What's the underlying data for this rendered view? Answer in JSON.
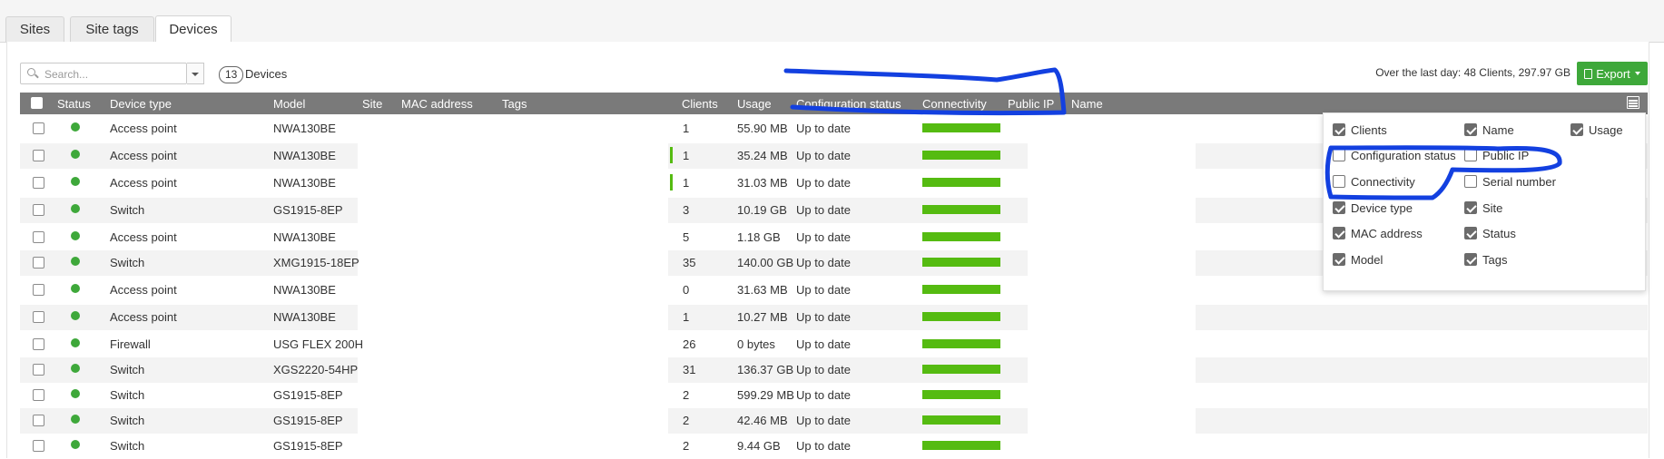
{
  "tabs": [
    {
      "label": "Sites",
      "active": false
    },
    {
      "label": "Site tags",
      "active": false
    },
    {
      "label": "Devices",
      "active": true
    }
  ],
  "toolbar": {
    "search_placeholder": "Search...",
    "device_count": "13",
    "device_count_label": "Devices",
    "summary": "Over the last day: 48 Clients, 297.97 GB",
    "export_label": "Export"
  },
  "columns": {
    "status": "Status",
    "device_type": "Device type",
    "model": "Model",
    "site": "Site",
    "mac": "MAC address",
    "tags": "Tags",
    "clients": "Clients",
    "usage": "Usage",
    "config": "Configuration status",
    "connectivity": "Connectivity",
    "public_ip": "Public IP",
    "name": "Name"
  },
  "rows": [
    {
      "type": "Access point",
      "model": "NWA130BE",
      "clients": "1",
      "usage": "55.90 MB",
      "config": "Up to date",
      "usage_bar": false
    },
    {
      "type": "Access point",
      "model": "NWA130BE",
      "clients": "1",
      "usage": "35.24 MB",
      "config": "Up to date",
      "usage_bar": true
    },
    {
      "type": "Access point",
      "model": "NWA130BE",
      "clients": "1",
      "usage": "31.03 MB",
      "config": "Up to date",
      "usage_bar": true
    },
    {
      "type": "Switch",
      "model": "GS1915-8EP",
      "clients": "3",
      "usage": "10.19 GB",
      "config": "Up to date",
      "usage_bar": false
    },
    {
      "type": "Access point",
      "model": "NWA130BE",
      "clients": "5",
      "usage": "1.18 GB",
      "config": "Up to date",
      "usage_bar": false
    },
    {
      "type": "Switch",
      "model": "XMG1915-18EP",
      "clients": "35",
      "usage": "140.00 GB",
      "config": "Up to date",
      "usage_bar": false
    },
    {
      "type": "Access point",
      "model": "NWA130BE",
      "clients": "0",
      "usage": "31.63 MB",
      "config": "Up to date",
      "usage_bar": false
    },
    {
      "type": "Access point",
      "model": "NWA130BE",
      "clients": "1",
      "usage": "10.27 MB",
      "config": "Up to date",
      "usage_bar": false
    },
    {
      "type": "Firewall",
      "model": "USG FLEX 200H",
      "clients": "26",
      "usage": "0 bytes",
      "config": "Up to date",
      "usage_bar": false
    },
    {
      "type": "Switch",
      "model": "XGS2220-54HP",
      "clients": "31",
      "usage": "136.37 GB",
      "config": "Up to date",
      "usage_bar": false
    },
    {
      "type": "Switch",
      "model": "GS1915-8EP",
      "clients": "2",
      "usage": "599.29 MB",
      "config": "Up to date",
      "usage_bar": false
    },
    {
      "type": "Switch",
      "model": "GS1915-8EP",
      "clients": "2",
      "usage": "42.46 MB",
      "config": "Up to date",
      "usage_bar": false
    },
    {
      "type": "Switch",
      "model": "GS1915-8EP",
      "clients": "2",
      "usage": "9.44 GB",
      "config": "Up to date",
      "usage_bar": false
    }
  ],
  "column_options": [
    {
      "label": "Clients",
      "checked": true
    },
    {
      "label": "Name",
      "checked": true
    },
    {
      "label": "Usage",
      "checked": true
    },
    {
      "label": "Configuration status",
      "checked": false
    },
    {
      "label": "Public IP",
      "checked": false
    },
    {
      "label": "Connectivity",
      "checked": false
    },
    {
      "label": "Serial number",
      "checked": false
    },
    {
      "label": "Device type",
      "checked": true
    },
    {
      "label": "Site",
      "checked": true
    },
    {
      "label": "MAC address",
      "checked": true
    },
    {
      "label": "Status",
      "checked": true
    },
    {
      "label": "Model",
      "checked": true
    },
    {
      "label": "Tags",
      "checked": true
    }
  ],
  "colors": {
    "accent_green": "#3ea83a",
    "connectivity_green": "#55bb11",
    "header_gray": "#7a7a7a",
    "annotation_blue": "#1340e0"
  }
}
